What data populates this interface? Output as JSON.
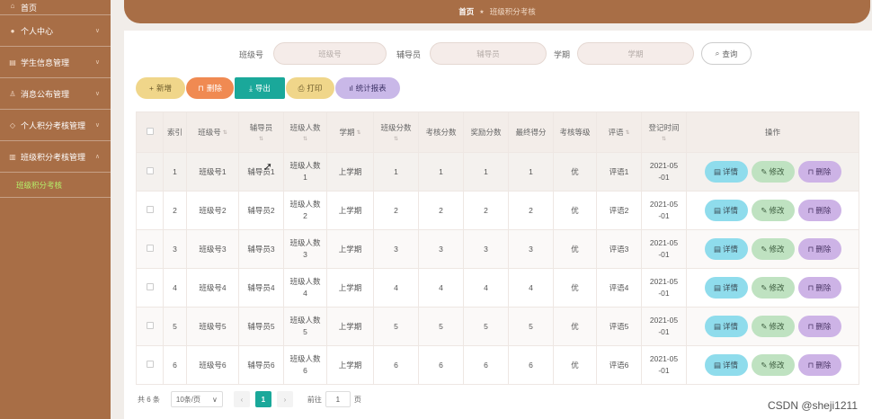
{
  "sidebar": {
    "home": {
      "label": "首页",
      "icon": "home-icon"
    },
    "items": [
      {
        "label": "个人中心",
        "icon": "user-icon"
      },
      {
        "label": "学生信息管理",
        "icon": "id-card-icon"
      },
      {
        "label": "消息公布管理",
        "icon": "person-icon"
      },
      {
        "label": "个人积分考核管理",
        "icon": "diamond-icon"
      },
      {
        "label": "班级积分考核管理",
        "icon": "bar-chart-icon"
      }
    ],
    "sub_item": "班级积分考核"
  },
  "breadcrumb": {
    "home": "首页",
    "current": "班级积分考核"
  },
  "search": {
    "class_label": "班级号",
    "class_placeholder": "班级号",
    "counselor_label": "辅导员",
    "counselor_placeholder": "辅导员",
    "term_label": "学期",
    "term_placeholder": "学期",
    "button": "查询"
  },
  "actions": {
    "add": "新增",
    "delete": "删除",
    "export": "导出",
    "print": "打印",
    "stats": "统计报表"
  },
  "table": {
    "headers": {
      "index": "索引",
      "class_no": "班级号",
      "counselor": "辅导员",
      "class_size": "班级人数",
      "term": "学期",
      "class_score": "班级分数",
      "assess_score": "考核分数",
      "reward_score": "奖励分数",
      "final_score": "最终得分",
      "grade": "考核等级",
      "comment": "评语",
      "reg_time": "登记时间",
      "ops": "操作"
    },
    "row_buttons": {
      "detail": "详情",
      "edit": "修改",
      "delete": "删除"
    },
    "rows": [
      {
        "index": "1",
        "class_no": "班级号1",
        "counselor": "辅导员1",
        "size_a": "班级人数",
        "size_b": "1",
        "term": "上学期",
        "class_score": "1",
        "assess_score": "1",
        "reward_score": "1",
        "final_score": "1",
        "grade": "优",
        "comment": "评语1",
        "time_a": "2021-05",
        "time_b": "-01"
      },
      {
        "index": "2",
        "class_no": "班级号2",
        "counselor": "辅导员2",
        "size_a": "班级人数",
        "size_b": "2",
        "term": "上学期",
        "class_score": "2",
        "assess_score": "2",
        "reward_score": "2",
        "final_score": "2",
        "grade": "优",
        "comment": "评语2",
        "time_a": "2021-05",
        "time_b": "-01"
      },
      {
        "index": "3",
        "class_no": "班级号3",
        "counselor": "辅导员3",
        "size_a": "班级人数",
        "size_b": "3",
        "term": "上学期",
        "class_score": "3",
        "assess_score": "3",
        "reward_score": "3",
        "final_score": "3",
        "grade": "优",
        "comment": "评语3",
        "time_a": "2021-05",
        "time_b": "-01"
      },
      {
        "index": "4",
        "class_no": "班级号4",
        "counselor": "辅导员4",
        "size_a": "班级人数",
        "size_b": "4",
        "term": "上学期",
        "class_score": "4",
        "assess_score": "4",
        "reward_score": "4",
        "final_score": "4",
        "grade": "优",
        "comment": "评语4",
        "time_a": "2021-05",
        "time_b": "-01"
      },
      {
        "index": "5",
        "class_no": "班级号5",
        "counselor": "辅导员5",
        "size_a": "班级人数",
        "size_b": "5",
        "term": "上学期",
        "class_score": "5",
        "assess_score": "5",
        "reward_score": "5",
        "final_score": "5",
        "grade": "优",
        "comment": "评语5",
        "time_a": "2021-05",
        "time_b": "-01"
      },
      {
        "index": "6",
        "class_no": "班级号6",
        "counselor": "辅导员6",
        "size_a": "班级人数",
        "size_b": "6",
        "term": "上学期",
        "class_score": "6",
        "assess_score": "6",
        "reward_score": "6",
        "final_score": "6",
        "grade": "优",
        "comment": "评语6",
        "time_a": "2021-05",
        "time_b": "-01"
      }
    ]
  },
  "pagination": {
    "total": "共 6 条",
    "page_size": "10条/页",
    "current_page": "1",
    "goto_label": "前往",
    "goto_value": "1",
    "page_suffix": "页"
  },
  "watermark": "CSDN @sheji1211",
  "colors": {
    "brand": "#a86e46",
    "accent": "#1aa89a",
    "sub_active": "#b5f06a"
  }
}
